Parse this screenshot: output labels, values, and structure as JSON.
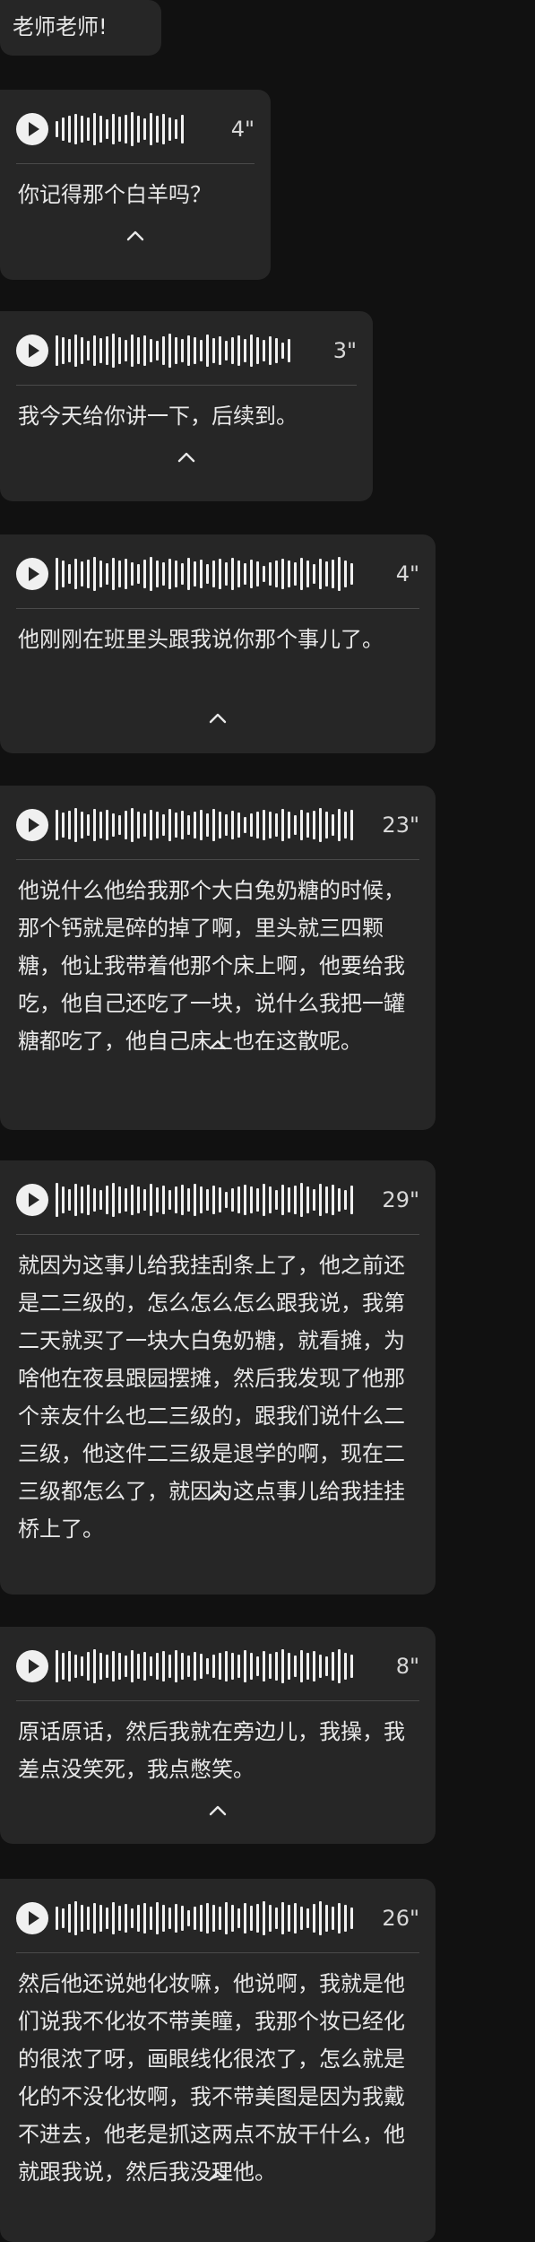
{
  "first_message": {
    "text": "老师老师!"
  },
  "voice_messages": [
    {
      "duration": "4\"",
      "transcript": "你记得那个白羊吗？"
    },
    {
      "duration": "3\"",
      "transcript": "我今天给你讲一下，后续到。"
    },
    {
      "duration": "4\"",
      "transcript": "他刚刚在班里头跟我说你那个事儿了。"
    },
    {
      "duration": "23\"",
      "transcript": "他说什么他给我那个大白兔奶糖的时候，那个钙就是碎的掉了啊，里头就三四颗糖，他让我带着他那个床上啊，他要给我吃，他自己还吃了一块，说什么我把一罐糖都吃了，他自己床上也在这散呢。"
    },
    {
      "duration": "29\"",
      "transcript": "就因为这事儿给我挂刮条上了，他之前还是二三级的，怎么怎么怎么跟我说，我第二天就买了一块大白兔奶糖，就看摊，为啥他在夜县跟园摆摊，然后我发现了他那个亲友什么也二三级的，跟我们说什么二三级，他这件二三级是退学的啊，现在二三级都怎么了，就因为这点事儿给我挂挂桥上了。"
    },
    {
      "duration": "8\"",
      "transcript": "原话原话，然后我就在旁边儿，我操，我差点没笑死，我点憋笑。"
    },
    {
      "duration": "26\"",
      "transcript": "然后他还说她化妆嘛，他说啊，我就是他们说我不化妆不带美瞳，我那个妆已经化的很浓了呀，画眼线化很浓了，怎么就是化的不没化妆啊，我不带美图是因为我戴不进去，他老是抓这两点不放干什么，他就跟我说，然后我没理他。"
    }
  ],
  "icons": {
    "play": "play-icon",
    "collapse": "chevron-up-icon"
  }
}
